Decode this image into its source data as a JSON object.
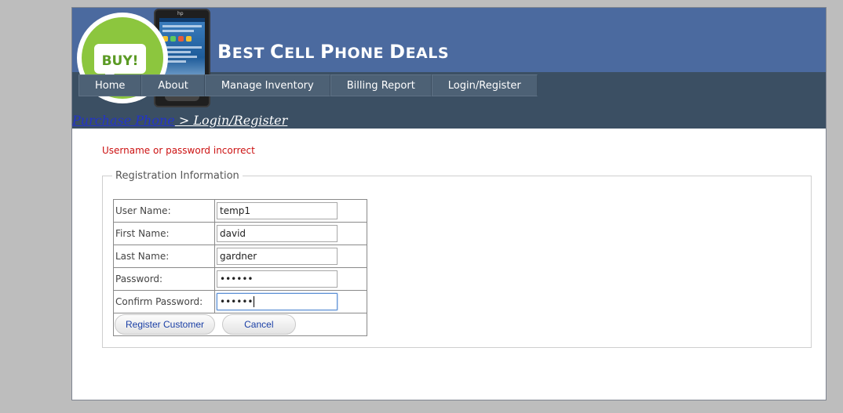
{
  "site": {
    "title_first_letters": [
      "B",
      "C",
      "P",
      "D"
    ],
    "title": "Best Cell Phone Deals",
    "logo_text": "BUY!",
    "phone_brand": "hp"
  },
  "nav": {
    "items": [
      "Home",
      "About",
      "Manage Inventory",
      "Billing Report",
      "Login/Register"
    ]
  },
  "breadcrumb": {
    "link": "Purchase Phone",
    "current": " > Login/Register"
  },
  "error": "Username or password incorrect",
  "form": {
    "legend": "Registration Information",
    "fields": [
      {
        "label": "User Name:",
        "value": "temp1"
      },
      {
        "label": "First Name:",
        "value": "david"
      },
      {
        "label": "Last Name:",
        "value": "gardner"
      },
      {
        "label": "Password:",
        "value": "••••••"
      },
      {
        "label": "Confirm Password:",
        "value": "••••••"
      }
    ],
    "register_label": "Register Customer",
    "cancel_label": "Cancel"
  },
  "colors": {
    "header": "#4b6a9f",
    "nav_band": "#3b4f63",
    "error": "#cc1111",
    "button_text": "#1a3fa6"
  }
}
